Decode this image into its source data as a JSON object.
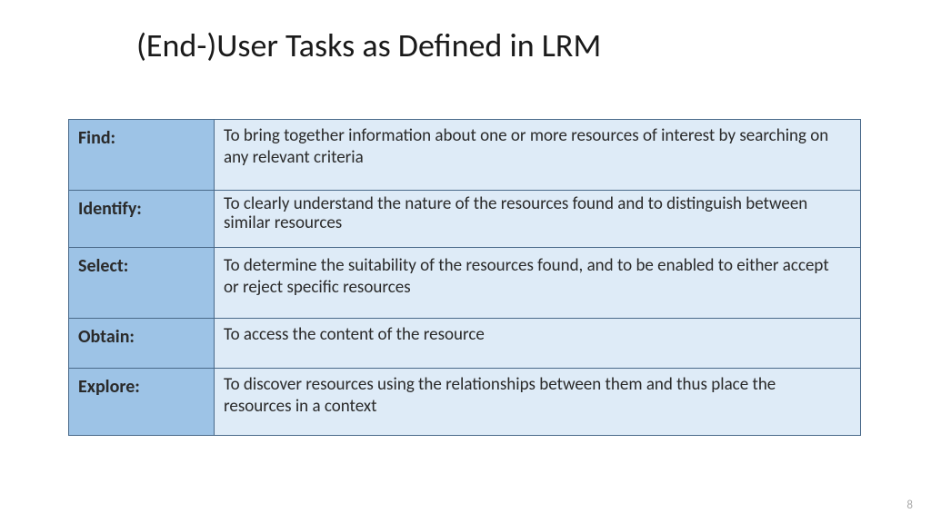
{
  "title": "(End-)User Tasks as Defined in LRM",
  "pageNumber": "8",
  "tasks": [
    {
      "label": "Find:",
      "description": "To bring together information about one or more resources of interest by searching on any relevant criteria"
    },
    {
      "label": "Identify:",
      "description": "To clearly understand the nature of the resources found and to distinguish between similar resources"
    },
    {
      "label": "Select:",
      "description": "To determine the suitability of the resources found, and to be enabled to either accept or reject specific resources"
    },
    {
      "label": "Obtain:",
      "description": "To access the content of the resource"
    },
    {
      "label": "Explore:",
      "description": "To discover resources using the relationships between them and thus place the resources in a context"
    }
  ]
}
